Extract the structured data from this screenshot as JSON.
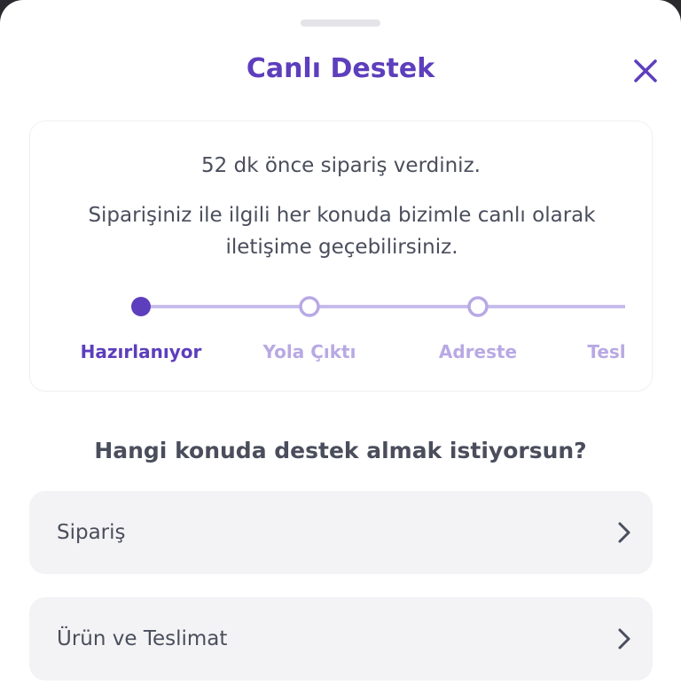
{
  "header": {
    "title": "Canlı Destek"
  },
  "order_info": {
    "time_text": "52 dk önce sipariş verdiniz.",
    "contact_text": "Siparişiniz ile ilgili her konuda bizimle canlı olarak iletişime geçebilirsiniz."
  },
  "progress": {
    "steps": [
      {
        "label": "Hazırlanıyor",
        "state": "active"
      },
      {
        "label": "Yola Çıktı",
        "state": "inactive"
      },
      {
        "label": "Adreste",
        "state": "inactive"
      },
      {
        "label": "Tesl",
        "state": "inactive"
      }
    ]
  },
  "support": {
    "question": "Hangi konuda destek almak istiyorsun?",
    "options": [
      {
        "label": "Sipariş"
      },
      {
        "label": "Ürün ve Teslimat"
      }
    ]
  },
  "colors": {
    "brand": "#5d3ebc",
    "inactive": "#b8a9e4",
    "text": "#4a4e5c",
    "option_bg": "#f3f3f5"
  },
  "icons": {
    "close": "close-icon",
    "option_arrow": "chevron-right-icon"
  }
}
